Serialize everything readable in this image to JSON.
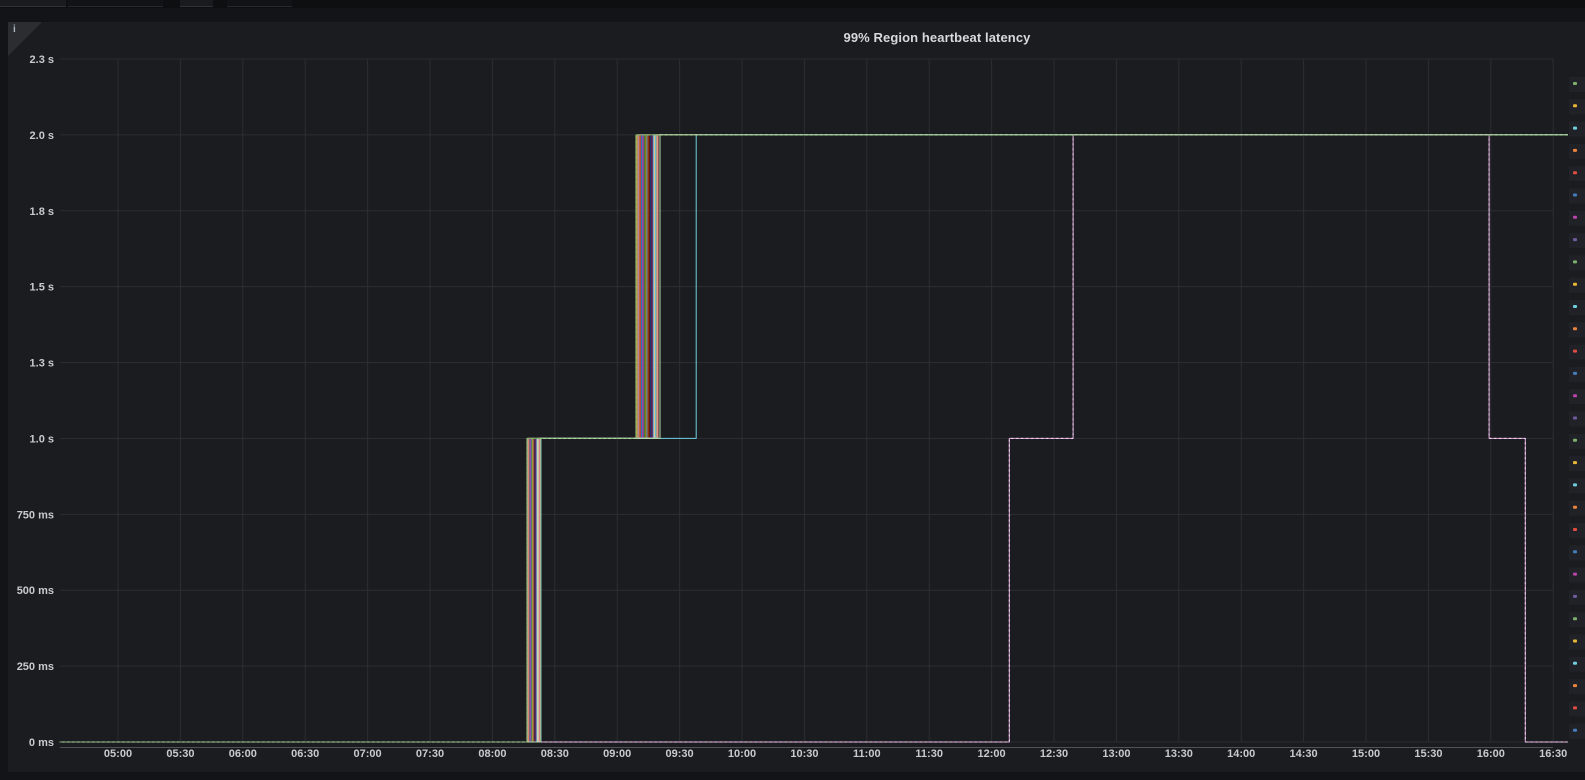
{
  "panel": {
    "title": "99% Region heartbeat latency",
    "info_icon": "i"
  },
  "chart_data": {
    "type": "line",
    "line_style": "step-after",
    "title": "99% Region heartbeat latency",
    "x_axis": {
      "tick_labels": [
        "05:00",
        "05:30",
        "06:00",
        "06:30",
        "07:00",
        "07:30",
        "08:00",
        "08:30",
        "09:00",
        "09:30",
        "10:00",
        "10:30",
        "11:00",
        "11:30",
        "12:00",
        "12:30",
        "13:00",
        "13:30",
        "14:00",
        "14:30",
        "15:00",
        "15:30",
        "16:00",
        "16:30"
      ],
      "range_minutes": [
        272,
        997
      ]
    },
    "y_axis": {
      "unit": "ms",
      "ticks": [
        {
          "label": "0 ms",
          "ms": 0
        },
        {
          "label": "250 ms",
          "ms": 250
        },
        {
          "label": "500 ms",
          "ms": 500
        },
        {
          "label": "750 ms",
          "ms": 750
        },
        {
          "label": "1.0 s",
          "ms": 1000
        },
        {
          "label": "1.3 s",
          "ms": 1250
        },
        {
          "label": "1.5 s",
          "ms": 1500
        },
        {
          "label": "1.8 s",
          "ms": 1750
        },
        {
          "label": "2.0 s",
          "ms": 2000
        },
        {
          "label": "2.3 s",
          "ms": 2250
        }
      ],
      "range_ms": [
        0,
        2250
      ]
    },
    "grid": true,
    "colors": {
      "grid": "#2c2d32",
      "axis_line": "#85878b",
      "text": "#c9cacc",
      "background": "#1b1c1f"
    },
    "legend": {
      "position": "right",
      "cropped": true,
      "marker_count": 30,
      "marker_colors": [
        "#7EB26D",
        "#EAB839",
        "#6ED0E0",
        "#EF843C",
        "#E24D42",
        "#447EBC",
        "#BA43A9",
        "#705DA0"
      ]
    },
    "series": [
      {
        "color": "#EAB839",
        "steps": [
          [
            272,
            0
          ],
          [
            496.9,
            1000
          ],
          [
            549.5,
            2000
          ]
        ]
      },
      {
        "color": "#AEA2E0",
        "steps": [
          [
            272,
            0
          ],
          [
            497.2,
            1000
          ],
          [
            550.1,
            2000
          ]
        ]
      },
      {
        "color": "#EF843C",
        "steps": [
          [
            272,
            0
          ],
          [
            497.5,
            1000
          ],
          [
            550.6,
            2000
          ]
        ]
      },
      {
        "color": "#E24D42",
        "steps": [
          [
            272,
            0
          ],
          [
            497.8,
            1000
          ],
          [
            551.1,
            2000
          ]
        ]
      },
      {
        "color": "#1F78C1",
        "steps": [
          [
            272,
            0
          ],
          [
            498.1,
            1000
          ],
          [
            551.7,
            2000
          ]
        ]
      },
      {
        "color": "#BA43A9",
        "steps": [
          [
            272,
            0
          ],
          [
            498.4,
            1000
          ],
          [
            552.2,
            2000
          ]
        ]
      },
      {
        "color": "#705DA0",
        "steps": [
          [
            272,
            0
          ],
          [
            498.7,
            1000
          ],
          [
            552.7,
            2000
          ]
        ]
      },
      {
        "color": "#508642",
        "steps": [
          [
            272,
            0
          ],
          [
            499.0,
            1000
          ],
          [
            553.2,
            2000
          ]
        ]
      },
      {
        "color": "#CCA300",
        "steps": [
          [
            272,
            0
          ],
          [
            499.3,
            1000
          ],
          [
            553.8,
            2000
          ]
        ]
      },
      {
        "color": "#447EBC",
        "steps": [
          [
            272,
            0
          ],
          [
            499.6,
            1000
          ],
          [
            554.3,
            2000
          ]
        ]
      },
      {
        "color": "#C15C17",
        "steps": [
          [
            272,
            0
          ],
          [
            499.9,
            1000
          ],
          [
            554.8,
            2000
          ]
        ]
      },
      {
        "color": "#890F02",
        "steps": [
          [
            272,
            0
          ],
          [
            500.2,
            1000
          ],
          [
            555.4,
            2000
          ]
        ]
      },
      {
        "color": "#0A437C",
        "steps": [
          [
            272,
            0
          ],
          [
            500.5,
            1000
          ],
          [
            555.9,
            2000
          ]
        ]
      },
      {
        "color": "#6D1F62",
        "steps": [
          [
            272,
            0
          ],
          [
            500.8,
            1000
          ],
          [
            556.4,
            2000
          ]
        ]
      },
      {
        "color": "#584477",
        "steps": [
          [
            272,
            0
          ],
          [
            501.1,
            1000
          ],
          [
            557.0,
            2000
          ]
        ]
      },
      {
        "color": "#82B5D8",
        "steps": [
          [
            272,
            0
          ],
          [
            501.4,
            1000
          ],
          [
            557.5,
            2000
          ]
        ]
      },
      {
        "color": "#F4D598",
        "steps": [
          [
            272,
            0
          ],
          [
            501.7,
            1000
          ],
          [
            558.0,
            2000
          ]
        ]
      },
      {
        "color": "#70DBED",
        "steps": [
          [
            272,
            0
          ],
          [
            502.0,
            1000
          ],
          [
            558.5,
            2000
          ]
        ]
      },
      {
        "color": "#F9BA8F",
        "steps": [
          [
            272,
            0
          ],
          [
            502.3,
            1000
          ],
          [
            559.1,
            2000
          ]
        ]
      },
      {
        "color": "#F29191",
        "steps": [
          [
            272,
            0
          ],
          [
            502.6,
            1000
          ],
          [
            559.6,
            2000
          ]
        ]
      },
      {
        "color": "#6ED0E0",
        "steps": [
          [
            272,
            0
          ],
          [
            503.3,
            1000
          ],
          [
            578.0,
            2000
          ]
        ]
      },
      {
        "color": "#7EB26D",
        "steps": [
          [
            272,
            0
          ],
          [
            496.6,
            1000
          ],
          [
            549.0,
            2000
          ]
        ],
        "overlay": "#7EB26D",
        "overlay_last": true
      },
      {
        "color": "#E5A8E2",
        "steps": [
          [
            272,
            0
          ],
          [
            728.5,
            1000
          ],
          [
            759.2,
            2000
          ],
          [
            959.2,
            1000
          ],
          [
            976.6,
            0
          ]
        ],
        "overlay": "#F3E2F5"
      },
      {
        "color": "#B7DBAB",
        "steps": [
          [
            272,
            0
          ],
          [
            503.2,
            1000
          ],
          [
            560.6,
            2000
          ]
        ]
      }
    ]
  }
}
